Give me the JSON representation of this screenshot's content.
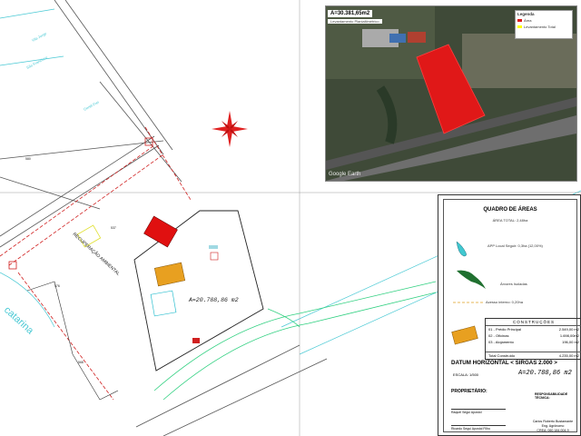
{
  "plan": {
    "area_label": "A=20.788,86 m2",
    "recuperacao_label": "RECUPERAÇÃO AMBIENTAL",
    "catarina_label": "catarina",
    "lot_labels": [
      "580",
      "576",
      "568",
      "537"
    ],
    "road_labels": [
      "Vila Jorge",
      "Gentil Frei",
      "São Francisco"
    ]
  },
  "aerial": {
    "area_label": "A=30.381,65m2",
    "subtitle": "Levantamento Planialtimétrico",
    "legend_title": "Legenda",
    "legend_items": [
      "Área",
      "Levantamento Total"
    ],
    "watermark": "Google Earth",
    "colors": {
      "area": "#e01818",
      "terrain": "#3f4a38"
    }
  },
  "panel": {
    "title": "QUADRO DE ÁREAS",
    "subtitle": "ÁREA TOTAL: 2,48ha",
    "app_label": "APP Local Seguir: 0,3ha (12,00%)",
    "arvores_label": "Árvores Isoladas",
    "acesso_label": "Acesso interno: 0,20ha",
    "construcoes_title": "CONSTRUÇÕES",
    "construcoes": [
      {
        "code": "01",
        "name": "Prédio Principal",
        "value": "2.549,00 m2"
      },
      {
        "code": "02",
        "name": "Oficinas",
        "value": "1.698,00m2"
      },
      {
        "code": "03",
        "name": "Alojamento",
        "value": "196,00 m2"
      }
    ],
    "total_label": "Total Construído",
    "total_value": "4.235,00 m2",
    "datum": "DATUM HORIZONTAL < SIRGAS 2.000 >",
    "escala": "ESCALA: 1/500",
    "area": "A=20.788,86 m2",
    "proprietario_title": "PROPRIETÁRIO:",
    "responsavel_title": "RESPONSABILIDADE TÉCNICA:",
    "owner1": "Raquel Segui Apostol",
    "owner2": "Ricardo Segui Apostol Filho",
    "engineer_name": "Carlos Roberto Bustamante",
    "engineer_title": "Eng. Agrônomo",
    "engineer_crea": "CREA: 060.184.004-9"
  },
  "colors": {
    "primary_structure": "#e01010",
    "secondary_structure": "#e8a020",
    "path": "#30d080",
    "boundary": "#d02020"
  }
}
